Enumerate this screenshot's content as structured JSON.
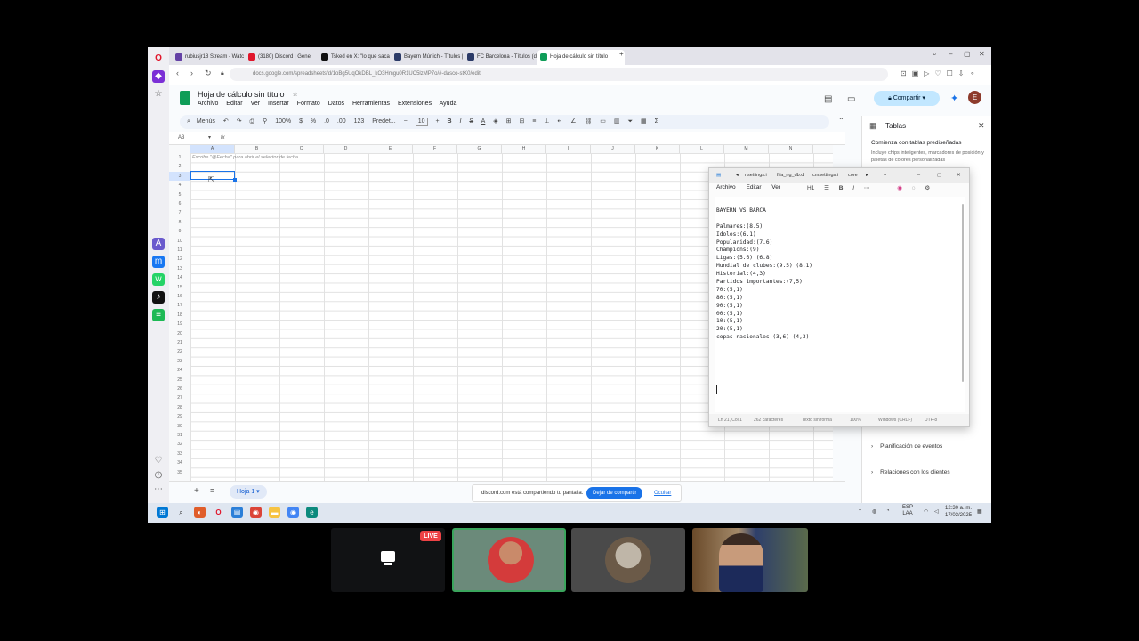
{
  "browser": {
    "tabs": [
      {
        "label": "rubiusjr18 Stream - Watc",
        "color": "#6441a5"
      },
      {
        "label": "(3180) Discord | Gene",
        "color": "#5865f2"
      },
      {
        "label": "Tsked en X: \"lo que saca",
        "color": "#111111"
      },
      {
        "label": "Bayern Múnich - Títulos |",
        "color": "#2b3a67"
      },
      {
        "label": "FC Barcelona - Títulos (d",
        "color": "#2b3a67"
      },
      {
        "label": "Hoja de cálculo sin título",
        "color": "#0f9d58"
      }
    ],
    "url": "docs.google.com/spreadsheets/d/1oBg5UqOkDBL_kO3Hmgu0R1UC5lzMP7o/#-dasco-stK0/edit"
  },
  "sheets": {
    "title": "Hoja de cálculo sin título",
    "menu": [
      "Archivo",
      "Editar",
      "Ver",
      "Insertar",
      "Formato",
      "Datos",
      "Herramientas",
      "Extensiones",
      "Ayuda"
    ],
    "share_label": "Compartir",
    "account_initial": "E",
    "toolbar": {
      "menus": "Menús",
      "zoom": "100%",
      "currency": "$",
      "percent": "%",
      "dec_less": ".0",
      "dec_more": ".00",
      "number_format": "123",
      "font": "Predet...",
      "font_size": "10"
    },
    "cell_ref": "A3",
    "fx": "fx",
    "columns": [
      "A",
      "B",
      "C",
      "D",
      "E",
      "F",
      "G",
      "H",
      "I",
      "J",
      "K",
      "L",
      "M",
      "N"
    ],
    "rows": [
      "1",
      "2",
      "3",
      "4",
      "5",
      "6",
      "7",
      "8",
      "9",
      "10",
      "11",
      "12",
      "13",
      "14",
      "15",
      "16",
      "17",
      "18",
      "19",
      "20",
      "21",
      "22",
      "23",
      "24",
      "25",
      "26",
      "27",
      "28",
      "29",
      "30",
      "31",
      "32",
      "33",
      "34",
      "35"
    ],
    "hint_text": "Escribe \"@Fecha\" para abrir el selector de fecha",
    "sheet_tab": "Hoja 1",
    "share_notice": {
      "message": "discord.com está compartiendo tu pantalla.",
      "stop_label": "Dejar de compartir",
      "hide_label": "Ocultar"
    }
  },
  "panel": {
    "title": "Tablas",
    "subtitle": "Comienza con tablas prediseñadas",
    "description": "Incluye chips inteligentes, marcadores de posición y paletas de colores personalizadas",
    "items": [
      "Planificación de eventos",
      "Relaciones con los clientes"
    ]
  },
  "notepad": {
    "tabs": [
      "nsettings.i",
      "fifa_ng_db.d",
      "cmsettings.i",
      "core"
    ],
    "menu": [
      "Archivo",
      "Editar",
      "Ver"
    ],
    "heading_tool": "H1",
    "lines": [
      "BAYERN VS BARCA",
      "",
      "Palmares:(8.5)",
      "Idolos:(6.1)",
      "Popularidad:(7.6)",
      "Champions:(9)",
      "Ligas:(5.6) (6.8)",
      "Mundial de clubes:(9.5) (8.1)",
      "Historial:(4,3)",
      "Partidos importantes:(7,5)",
      "70:(5,1)",
      "80:(5,1)",
      "90:(5,1)",
      "00:(5,1)",
      "10:(5,1)",
      "20:(5,1)",
      "copas nacionales:(3,6) (4,3)"
    ],
    "status": {
      "position": "Ln 21, Col 1",
      "chars": "262 caracteres",
      "format": "Texto sin forma",
      "zoom": "100%",
      "eol": "Windows (CRLF)",
      "encoding": "UTF-8"
    }
  },
  "taskbar": {
    "lang": "ESP",
    "lang2": "LAA",
    "time": "12:30 a. m.",
    "date": "17/03/2025"
  },
  "call": {
    "live_label": "LIVE"
  }
}
